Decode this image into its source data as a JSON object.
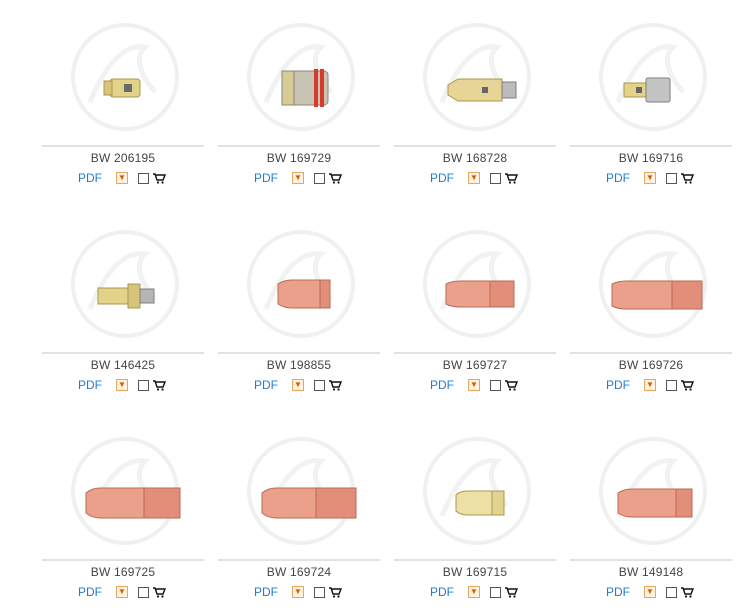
{
  "products": [
    {
      "code": "BW 206195",
      "pdf_label": "PDF",
      "image": "nozzle-holder-brass"
    },
    {
      "code": "BW 169729",
      "pdf_label": "PDF",
      "image": "insulator-steel-red-ring"
    },
    {
      "code": "BW 168728",
      "pdf_label": "PDF",
      "image": "tip-holder-brass"
    },
    {
      "code": "BW 169716",
      "pdf_label": "PDF",
      "image": "adapter-brass-steel"
    },
    {
      "code": "BW 146425",
      "pdf_label": "PDF",
      "image": "tip-holder-threaded-brass"
    },
    {
      "code": "BW 198855",
      "pdf_label": "PDF",
      "image": "gas-nozzle-copper"
    },
    {
      "code": "BW 169727",
      "pdf_label": "PDF",
      "image": "gas-nozzle-copper"
    },
    {
      "code": "BW 169726",
      "pdf_label": "PDF",
      "image": "gas-nozzle-copper"
    },
    {
      "code": "BW 169725",
      "pdf_label": "PDF",
      "image": "gas-nozzle-copper"
    },
    {
      "code": "BW 169724",
      "pdf_label": "PDF",
      "image": "gas-nozzle-copper"
    },
    {
      "code": "BW 169715",
      "pdf_label": "PDF",
      "image": "gas-nozzle-brass"
    },
    {
      "code": "BW 149148",
      "pdf_label": "PDF",
      "image": "gas-nozzle-copper"
    }
  ],
  "icons": {
    "download": "download-icon",
    "compare": "compare-checkbox",
    "cart": "cart-icon"
  },
  "colors": {
    "pdf_link": "#1f7bd0",
    "code_text": "#444444",
    "separator": "#e2e2e2",
    "copper": "#e8907a",
    "brass": "#e6d99a"
  }
}
